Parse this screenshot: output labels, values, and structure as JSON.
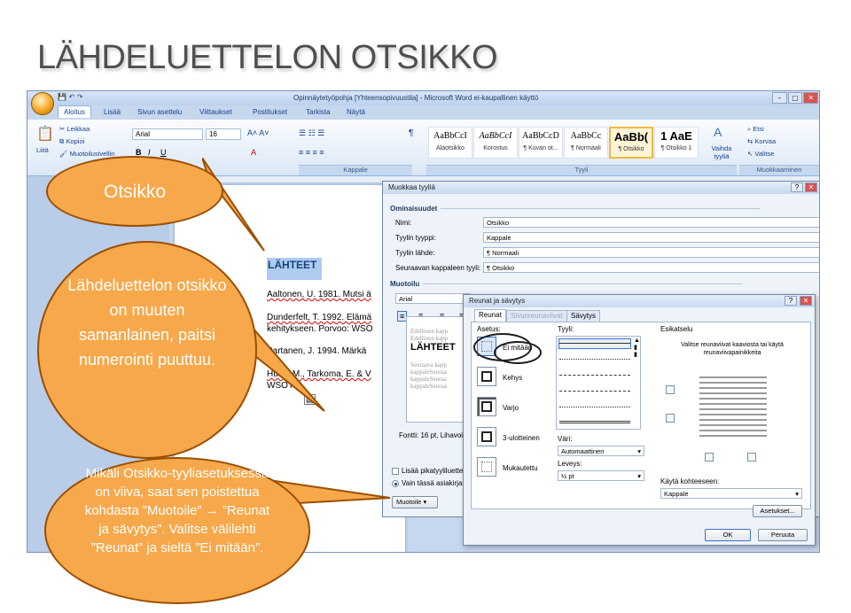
{
  "slide": {
    "title": "LÄHDELUETTELON OTSIKKO"
  },
  "window": {
    "title": "Opinnäytetyöpohja [Yhteensopivuustila] - Microsoft Word ei-kaupallinen käyttö",
    "tabs": [
      "Aloitus",
      "Lisää",
      "Sivun asettelu",
      "Viittaukset",
      "Postitukset",
      "Tarkista",
      "Näytä"
    ]
  },
  "ribbon": {
    "clipboard": {
      "paste": "Liitä",
      "cut": "Leikkaa",
      "copy": "Kopioi",
      "format_painter": "Muotoilusivellin"
    },
    "font_name": "Arial",
    "font_size": "16",
    "group_paragraph": "Kappale",
    "group_styles": "Tyyli",
    "group_editing": "Muokkaaminen",
    "styles": [
      {
        "preview": "AaBbCcI",
        "name": "Alaotsikko"
      },
      {
        "preview": "AaBbCcI",
        "name": "Korostus"
      },
      {
        "preview": "AaBbCcD",
        "name": "¶ Kuvan ot..."
      },
      {
        "preview": "AaBbCc",
        "name": "¶ Normaali"
      },
      {
        "preview": "AaBb(",
        "name": "¶ Otsikko"
      },
      {
        "preview": "1 AaE",
        "name": "¶ Otsikko 1"
      }
    ],
    "change_styles": "Vaihda tyyliä",
    "find": "Etsi",
    "replace": "Korvaa",
    "select": "Valitse"
  },
  "document": {
    "heading": "LÄHTEET",
    "refs": [
      "Aaltonen, U. 1981. Mutsi ä",
      "Dunderfelt, T. 1992. Elämä",
      "kehitykseen. Porvoo: WSO",
      "Partanen, J. 1994. Märkä",
      "Husu, M., Tarkoma, E. & V",
      "WSOY."
    ]
  },
  "modify_style": {
    "title": "Muokkaa tyyliä",
    "section_properties": "Ominaisuudet",
    "name_label": "Nimi:",
    "name_value": "Otsikko",
    "type_label": "Tyylin tyyppi:",
    "type_value": "Kappale",
    "based_label": "Tyylin lähde:",
    "based_value": "¶ Normaali",
    "next_label": "Seuraavan kappaleen tyyli:",
    "next_value": "¶ Otsikko",
    "section_format": "Muotoilu",
    "format_font": "Arial",
    "preview_prev1": "Edellinen kapp",
    "preview_prev2": "Edellinen kapp",
    "preview_heading": "LÄHTEET",
    "preview_next1": "Seuraava kapp",
    "preview_next2": "kappaleSeuraa",
    "preview_next3": "kappaleSeuraa",
    "preview_next4": "kappaleSeuraa",
    "font_desc": "Fontti: 16 pt, Lihavoitu",
    "add_quick": "Lisää pikatyyliluettelo",
    "only_doc": "Vain tässä asiakirjassa",
    "format_button": "Muotoile"
  },
  "borders": {
    "title": "Reunat ja sävytys",
    "tabs": [
      "Reunat",
      "Sivunreunaviivat",
      "Sävytys"
    ],
    "setting_label": "Asetus:",
    "settings": [
      "Ei mitään",
      "Kehys",
      "Varjo",
      "3-ulotteinen",
      "Mukautettu"
    ],
    "style_label": "Tyyli:",
    "color_label": "Väri:",
    "color_value": "Automaattinen",
    "width_label": "Leveys:",
    "width_value": "½ pt",
    "preview_label": "Esikatselu",
    "preview_hint": "Valitse reunaviivat kaaviosta tai käytä reunaviivapainikkeita",
    "apply_label": "Käytä kohteeseen:",
    "apply_value": "Kappale",
    "options": "Asetukset...",
    "ok": "OK",
    "cancel": "Peruuta"
  },
  "callouts": {
    "c1": "Otsikko",
    "c2": "Lähdeluettelon otsikko on muuten samanlainen, paitsi numerointi puuttuu.",
    "c3": "Mikäli Otsikko-tyyliasetuksessa on viiva, saat sen poistettua kohdasta ”Muotoile” → ”Reunat ja sävytys”. Valitse välilehti ”Reunat” ja sieltä ”Ei mitään”."
  },
  "colors": {
    "callout_fill": "#f7a84b",
    "callout_border": "#9a4f00",
    "title_text": "#4f4f4f",
    "ribbon_text": "#15428b"
  }
}
